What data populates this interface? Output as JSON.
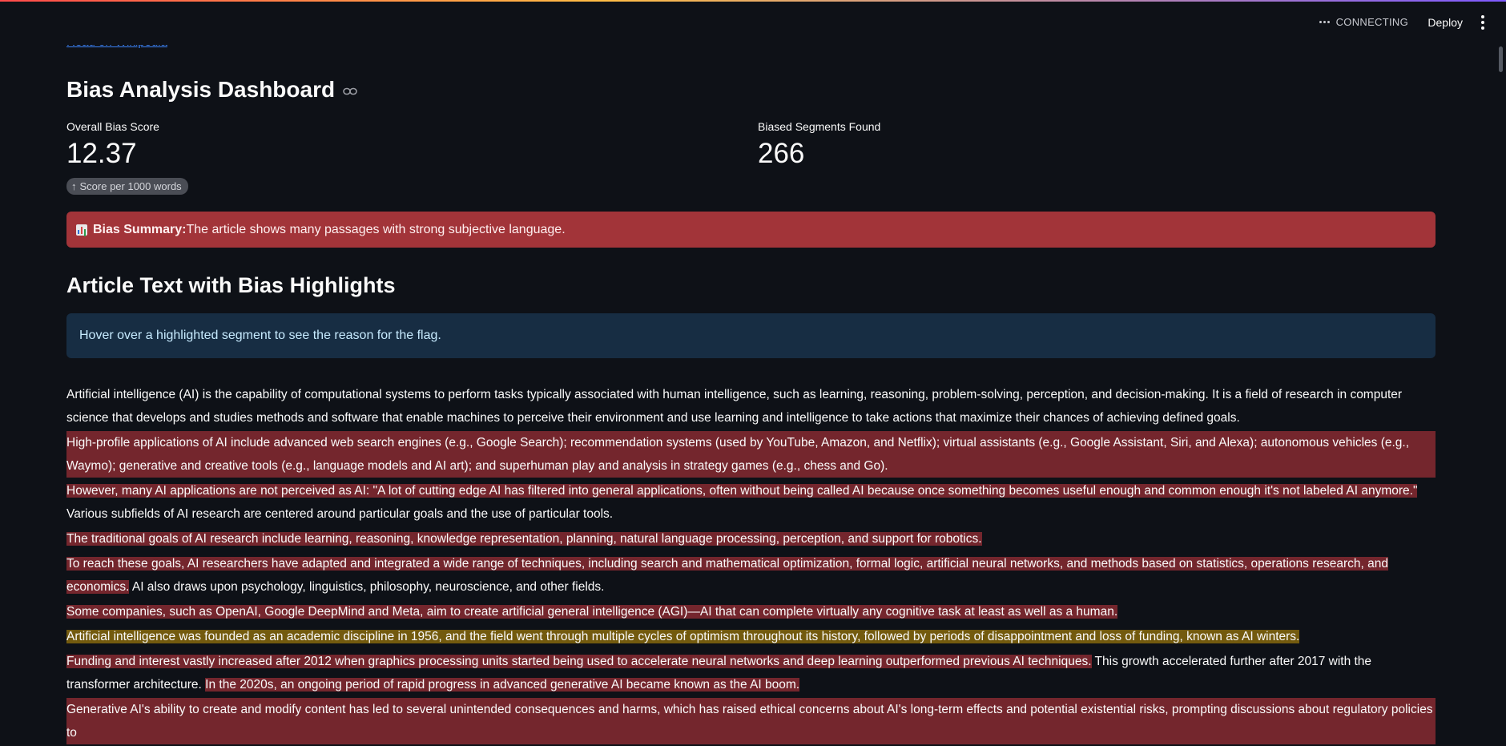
{
  "header": {
    "status": "CONNECTING",
    "deploy_label": "Deploy"
  },
  "top_link": "Read on Wikipedia",
  "title": "Bias Analysis Dashboard",
  "metrics": [
    {
      "label": "Overall Bias Score",
      "value": "12.37",
      "delta": "Score per 1000 words"
    },
    {
      "label": "Biased Segments Found",
      "value": "266"
    }
  ],
  "summary": {
    "label": "Bias Summary:",
    "text": " The article shows many passages with strong subjective language."
  },
  "article_heading": "Article Text with Bias Highlights",
  "info_text": "Hover over a highlighted segment to see the reason for the flag.",
  "article": {
    "p1": "Artificial intelligence (AI) is the capability of computational systems to perform tasks typically associated with human intelligence, such as learning, reasoning, problem-solving, perception, and decision-making. It is a field of research in computer science that develops and studies methods and software that enable machines to perceive their environment and use learning and intelligence to take actions that maximize their chances of achieving defined goals.",
    "p2": "High-profile applications of AI include advanced web search engines (e.g., Google Search); recommendation systems (used by YouTube, Amazon, and Netflix); virtual assistants (e.g., Google Assistant, Siri, and Alexa); autonomous vehicles (e.g., Waymo); generative and creative tools (e.g., language models and AI art); and superhuman play and analysis in strategy games (e.g., chess and Go).",
    "p3_hl": "However, many AI applications are not perceived as AI: \"A lot of cutting edge AI has filtered into general applications, often without being called AI because once something becomes useful enough and common enough it's not labeled AI anymore.\"",
    "p3_plain": " Various subfields of AI research are centered around particular goals and the use of particular tools.",
    "p4": "The traditional goals of AI research include learning, reasoning, knowledge representation, planning, natural language processing, perception, and support for robotics.",
    "p5_hl": "To reach these goals, AI researchers have adapted and integrated a wide range of techniques, including search and mathematical optimization, formal logic, artificial neural networks, and methods based on statistics, operations research, and economics.",
    "p5_plain": " AI also draws upon psychology, linguistics, philosophy, neuroscience, and other fields.",
    "p6": "Some companies, such as OpenAI, Google DeepMind and Meta, aim to create artificial general intelligence (AGI)—AI that can complete virtually any cognitive task at least as well as a human.",
    "p7": "Artificial intelligence was founded as an academic discipline in 1956, and the field went through multiple cycles of optimism throughout its history, followed by periods of disappointment and loss of funding, known as AI winters.",
    "p8_hl1": "Funding and interest vastly increased after 2012 when graphics processing units started being used to accelerate neural networks and deep learning outperformed previous AI techniques.",
    "p8_plain": " This growth accelerated further after 2017 with the transformer architecture. ",
    "p8_hl2": "In the 2020s, an ongoing period of rapid progress in advanced generative AI became known as the AI boom.",
    "p9": "Generative AI's ability to create and modify content has led to several unintended consequences and harms, which has raised ethical concerns about AI's long-term effects and potential existential risks, prompting discussions about regulatory policies to"
  },
  "colors": {
    "background": "#0e1117",
    "error_bg": "#a23439",
    "info_bg": "#172d43",
    "highlight_red": "#74262d",
    "highlight_yellow": "#735a0e"
  }
}
